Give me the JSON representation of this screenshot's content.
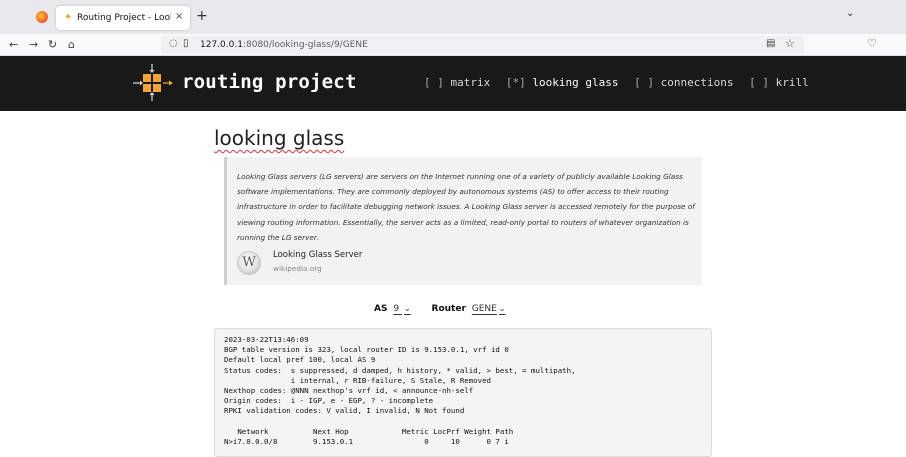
{
  "browser": {
    "tab_title": "Routing Project - Looking",
    "tab_close": "×",
    "new_tab": "+",
    "tab_list": "⌄",
    "url_host": "127.0.0.1",
    "url_path": ":8080/looking-glass/9/GENE"
  },
  "header": {
    "brand": "routing project",
    "nav": [
      {
        "mark": "[ ]",
        "label": "matrix"
      },
      {
        "mark": "[*]",
        "label": "looking glass"
      },
      {
        "mark": "[ ]",
        "label": "connections"
      },
      {
        "mark": "[ ]",
        "label": "krill"
      }
    ]
  },
  "page": {
    "title": "looking glass",
    "quote": "Looking Glass servers (LG servers) are servers on the Internet running one of a variety of publicly available Looking Glass software implementations. They are commonly deployed by autonomous systems (AS) to offer access to their routing infrastructure in order to facilitate debugging network issues. A Looking Glass server is accessed remotely for the purpose of viewing routing information. Essentially, the server acts as a limited, read-only portal to routers of whatever organization is running the LG server.",
    "card_title": "Looking Glass Server",
    "card_sub": "wikipedia.org",
    "as_label": "AS",
    "as_value": "9",
    "router_label": "Router",
    "router_value": "GENE",
    "output": "2023-03-22T13:46:09\nBGP table version is 323, local router ID is 9.153.0.1, vrf id 0\nDefault local pref 100, local AS 9\nStatus codes:  s suppressed, d damped, h history, * valid, > best, = multipath,\n               i internal, r RIB-failure, S Stale, R Removed\nNexthop codes: @NNN nexthop's vrf id, < announce-nh-self\nOrigin codes:  i - IGP, e - EGP, ? - incomplete\nRPKI validation codes: V valid, I invalid, N Not found\n\n   Network          Next Hop            Metric LocPrf Weight Path\nN>i7.0.0.0/8        9.153.0.1                0     10      0 7 i"
  },
  "colors": {
    "header_bg": "#191919",
    "logo_accent": "#f2a33a",
    "quote_bg": "#f2f2f2"
  }
}
